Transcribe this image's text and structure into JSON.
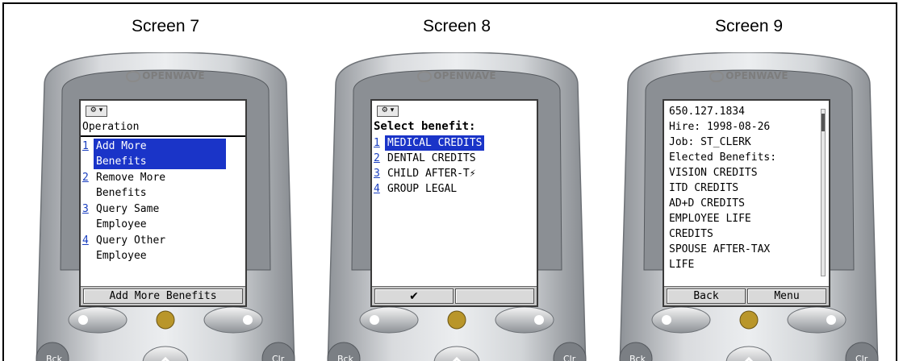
{
  "screens": [
    {
      "title": "Screen 7",
      "brand": "OPENWAVE",
      "indicator": "⚙ ▾",
      "label": "Operation",
      "items": [
        {
          "num": "1",
          "text": "Add More\nBenefits",
          "selected": true
        },
        {
          "num": "2",
          "text": "Remove More\nBenefits",
          "selected": false
        },
        {
          "num": "3",
          "text": "Query Same\nEmployee",
          "selected": false
        },
        {
          "num": "4",
          "text": "Query Other\nEmployee",
          "selected": false
        }
      ],
      "softkeys": [
        "Add More Benefits"
      ]
    },
    {
      "title": "Screen 8",
      "brand": "OPENWAVE",
      "indicator": "⚙ ▾",
      "label": "Select benefit:",
      "items": [
        {
          "num": "1",
          "text": "MEDICAL CREDITS",
          "selected": true
        },
        {
          "num": "2",
          "text": "DENTAL CREDITS",
          "selected": false
        },
        {
          "num": "3",
          "text": "CHILD AFTER-T⚡",
          "selected": false
        },
        {
          "num": "4",
          "text": "GROUP LEGAL",
          "selected": false
        }
      ],
      "softkeys": [
        "✔",
        ""
      ]
    },
    {
      "title": "Screen 9",
      "brand": "OPENWAVE",
      "lines": [
        "650.127.1834",
        "Hire: 1998-08-26",
        "Job: ST_CLERK",
        "Elected Benefits:",
        "VISION CREDITS",
        "ITD CREDITS",
        "AD+D CREDITS",
        "EMPLOYEE LIFE",
        "CREDITS",
        "SPOUSE AFTER-TAX",
        "LIFE"
      ],
      "softkeys": [
        "Back",
        "Menu"
      ]
    }
  ],
  "keypad": {
    "left_label": "Bck",
    "right_label": "Clr",
    "up_symbol": "^"
  },
  "colors": {
    "selection": "#1a34c8",
    "link_number": "#1a3fc0",
    "phone_body": "#b9bcc0"
  }
}
